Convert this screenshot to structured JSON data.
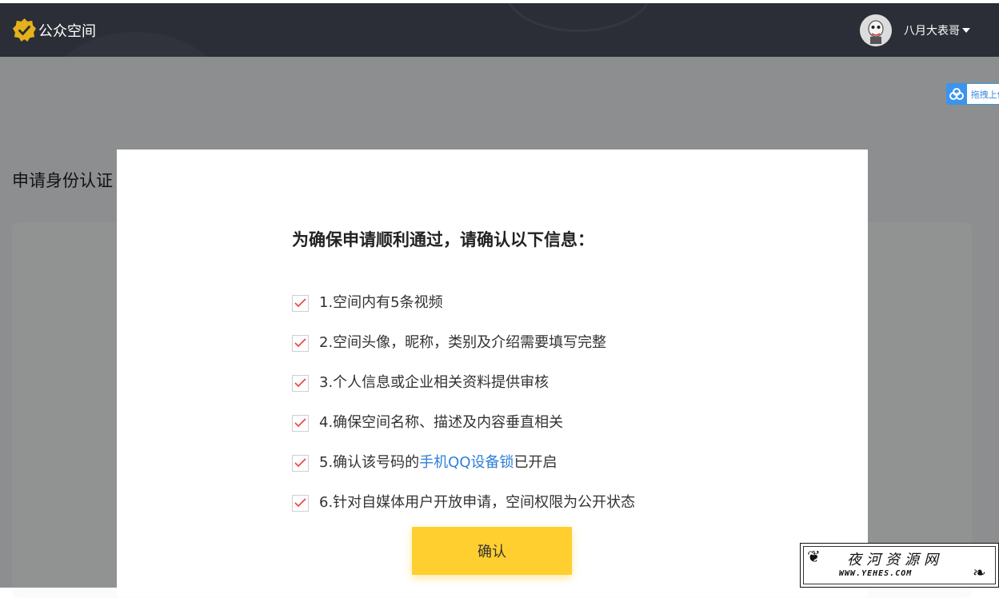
{
  "header": {
    "app_name": "公众空间",
    "user_name": "八月大表哥",
    "brand_color": "#2b2e36",
    "logo_color": "#e3b21b"
  },
  "page": {
    "title": "申请身份认证"
  },
  "side_widget": {
    "label": "拖拽上传",
    "icon": "cloud-icon"
  },
  "modal": {
    "title": "为确保申请顺利通过，请确认以下信息：",
    "items": [
      {
        "text": "1.空间内有5条视频",
        "checked": true
      },
      {
        "text": "2.空间头像，昵称，类别及介绍需要填写完整",
        "checked": true
      },
      {
        "text": "3.个人信息或企业相关资料提供审核",
        "checked": true
      },
      {
        "text": "4.确保空间名称、描述及内容垂直相关",
        "checked": true
      },
      {
        "prefix": "5.确认该号码的",
        "link": "手机QQ设备锁",
        "suffix": "已开启",
        "checked": true
      },
      {
        "text": "6.针对自媒体用户开放申请，空间权限为公开状态",
        "checked": true
      }
    ],
    "confirm_label": "确认",
    "confirm_color": "#fecf2f",
    "check_color": "#e8403a",
    "link_color": "#2d7fd6"
  },
  "watermark": {
    "title": "夜河资源网",
    "url": "WWW.YEHES.COM"
  }
}
